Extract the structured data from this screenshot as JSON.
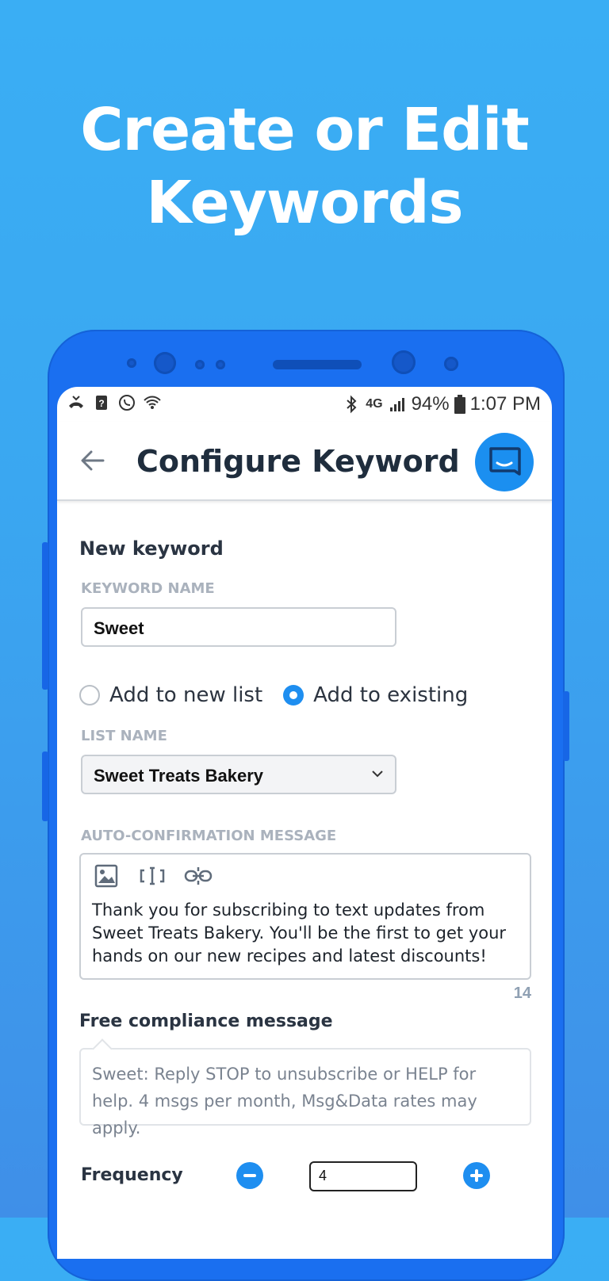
{
  "headline": {
    "line1": "Create or Edit",
    "line2": "Keywords"
  },
  "status_bar": {
    "battery": "94%",
    "time": "1:07 PM",
    "network": "4G"
  },
  "app_bar": {
    "title": "Configure Keyword"
  },
  "form": {
    "section_title": "New keyword",
    "keyword_name_label": "KEYWORD NAME",
    "keyword_name_value": "Sweet",
    "radio_new_list": "Add to new list",
    "radio_existing": "Add to existing",
    "list_name_label": "LIST NAME",
    "list_name_value": "Sweet Treats Bakery",
    "auto_conf_label": "AUTO-CONFIRMATION MESSAGE",
    "auto_conf_message": "Thank you for subscribing to text updates from Sweet Treats Bakery. You'll be the first to get your hands on our new recipes and latest discounts!",
    "char_counter": "14",
    "compliance_title": "Free compliance message",
    "compliance_text": "Sweet: Reply STOP to unsubscribe or HELP for help. 4 msgs per month, Msg&Data rates may apply.",
    "frequency_label": "Frequency",
    "frequency_value": "4"
  },
  "colors": {
    "background": "#3aaef4",
    "phone_body": "#1a6ff0",
    "accent": "#1e8ef0"
  }
}
